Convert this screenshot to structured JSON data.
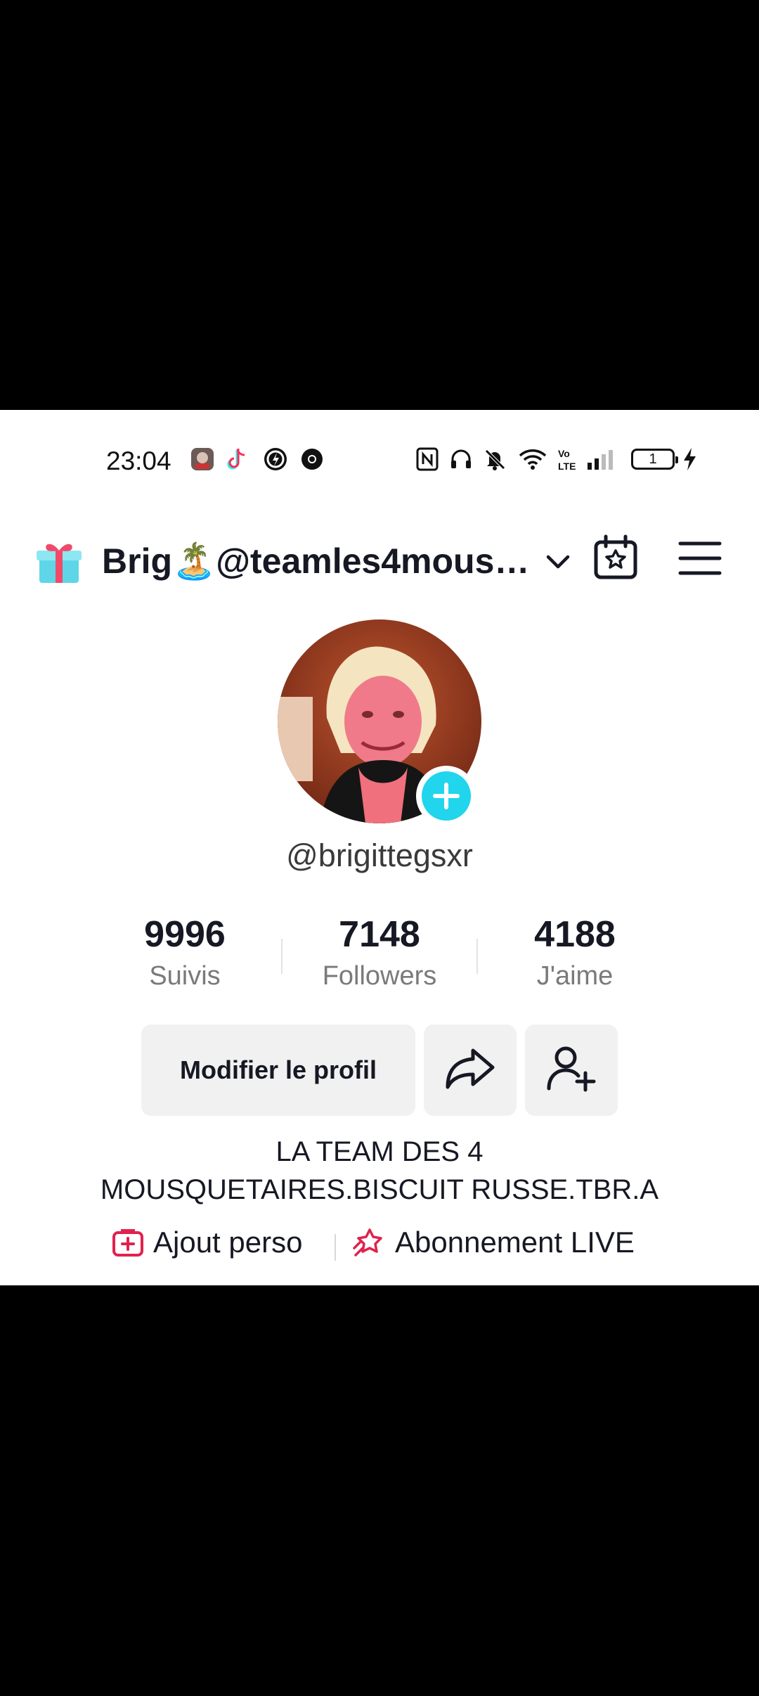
{
  "status_bar": {
    "time": "23:04",
    "battery_level": "1",
    "icons": [
      "notification-app-icon",
      "tiktok-icon",
      "app-icon",
      "chrome-icon",
      "nfc-icon",
      "headphones-icon",
      "mute-icon",
      "wifi-icon",
      "volte-icon",
      "signal-icon",
      "battery-icon",
      "charging-icon"
    ]
  },
  "header": {
    "title": "Brig🏝️@teamles4mous…",
    "gift_icon": "gift-icon",
    "chevron_icon": "chevron-down-icon",
    "calendar_icon": "calendar-star-icon",
    "menu_icon": "hamburger-menu-icon"
  },
  "profile": {
    "handle": "@brigittegsxr",
    "add_icon": "plus-icon",
    "accent": "#20d5ec"
  },
  "stats": [
    {
      "value": "9996",
      "label": "Suivis"
    },
    {
      "value": "7148",
      "label": "Followers"
    },
    {
      "value": "4188",
      "label": "J'aime"
    }
  ],
  "actions": {
    "edit_profile": "Modifier le profil",
    "share_icon": "share-arrow-icon",
    "add_friend_icon": "add-friend-icon"
  },
  "bio": {
    "line1": "LA TEAM DES 4",
    "line2": "MOUSQUETAIRES.BISCUIT RUSSE.TBR.A"
  },
  "links": [
    {
      "label": "Ajout perso",
      "icon": "add-box-icon",
      "color": "#e0224e"
    },
    {
      "label": "Abonnement LIVE",
      "icon": "star-subscription-icon",
      "color": "#e0224e"
    }
  ]
}
